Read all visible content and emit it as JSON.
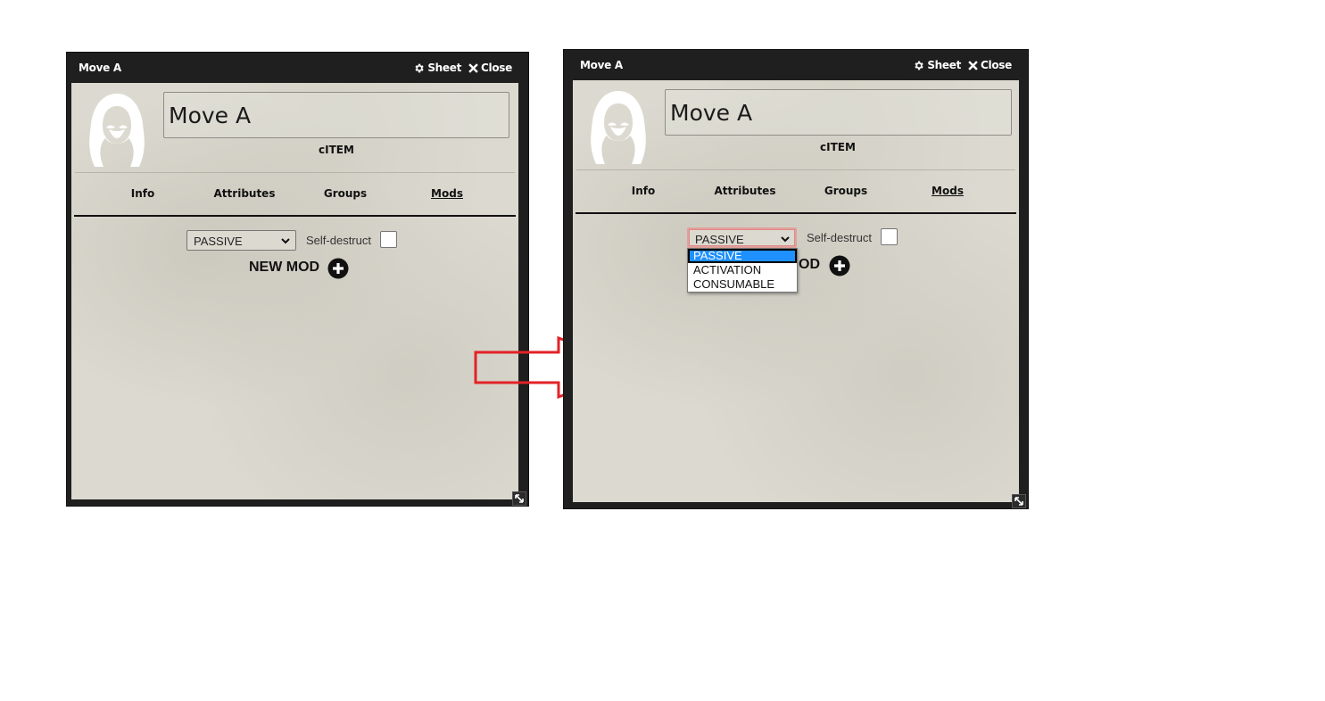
{
  "left_window": {
    "title": "Move A",
    "sheet_label": "Sheet",
    "close_label": "Close",
    "name_value": "Move A",
    "item_type": "cITEM",
    "tabs": [
      {
        "label": "Info",
        "active": false
      },
      {
        "label": "Attributes",
        "active": false
      },
      {
        "label": "Groups",
        "active": false
      },
      {
        "label": "Mods",
        "active": true
      }
    ],
    "mod_type_select": "PASSIVE",
    "self_destruct_label": "Self-destruct",
    "self_destruct_checked": false,
    "new_mod_label": "NEW MOD"
  },
  "right_window": {
    "title": "Move A",
    "sheet_label": "Sheet",
    "close_label": "Close",
    "name_value": "Move A",
    "item_type": "cITEM",
    "tabs": [
      {
        "label": "Info",
        "active": false
      },
      {
        "label": "Attributes",
        "active": false
      },
      {
        "label": "Groups",
        "active": false
      },
      {
        "label": "Mods",
        "active": true
      }
    ],
    "mod_type_select": "PASSIVE",
    "self_destruct_label": "Self-destruct",
    "self_destruct_checked": false,
    "new_mod_label_visible": "OD",
    "dropdown_options": [
      "PASSIVE",
      "ACTIVATION",
      "CONSUMABLE"
    ],
    "dropdown_selected": "PASSIVE"
  },
  "colors": {
    "window_frame": "#1f1f1f",
    "parchment": "#dcdad0",
    "option_highlight": "#1e90ff",
    "annotation_arrow": "#e32227"
  },
  "icons": [
    "gear-icon",
    "close-icon",
    "hooded-avatar-icon",
    "chevron-down-icon",
    "plus-circle-icon",
    "resize-icon",
    "red-arrow-annotation"
  ]
}
